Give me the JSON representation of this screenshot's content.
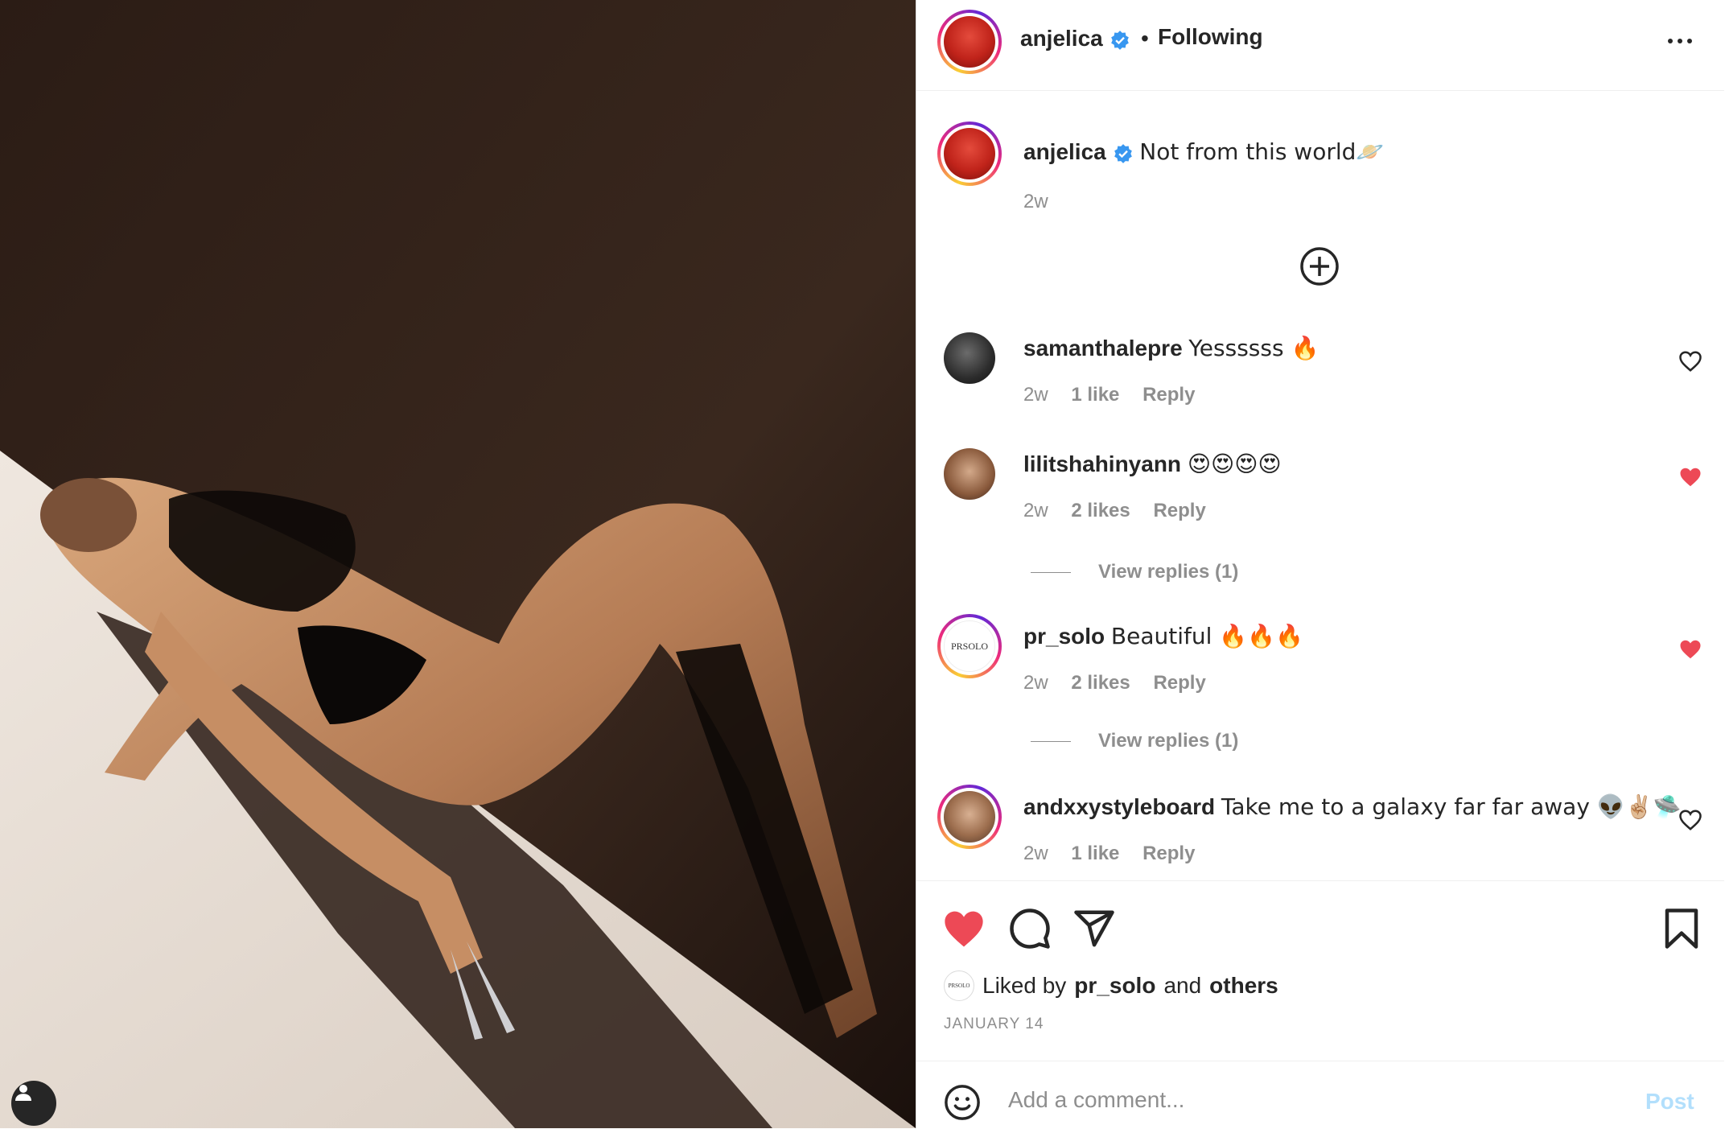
{
  "post": {
    "author": "anjelica",
    "follow_status": "Following",
    "separator": "•",
    "caption": "Not from this world🪐",
    "caption_age": "2w",
    "date": "JANUARY 14"
  },
  "comments": [
    {
      "user": "samanthalepre",
      "text": "Yessssss 🔥",
      "age": "2w",
      "likes": "1 like",
      "reply": "Reply",
      "liked": false
    },
    {
      "user": "lilitshahinyann",
      "text": "😍😍😍😍",
      "age": "2w",
      "likes": "2 likes",
      "reply": "Reply",
      "liked": true,
      "view_replies": "View replies (1)"
    },
    {
      "user": "pr_solo",
      "text": "Beautiful 🔥🔥🔥",
      "age": "2w",
      "likes": "2 likes",
      "reply": "Reply",
      "liked": true,
      "view_replies": "View replies (1)",
      "avatar_text": "PRSOLO"
    },
    {
      "user": "andxxystyleboard",
      "text": "Take me to a galaxy far far away 👽✌🏼🛸",
      "age": "2w",
      "likes": "1 like",
      "reply": "Reply",
      "liked": false
    }
  ],
  "likes_line": {
    "prefix": "Liked by",
    "user": "pr_solo",
    "conj": "and",
    "others": "others",
    "mini_avatar_text": "PRSOLO"
  },
  "composer": {
    "placeholder": "Add a comment...",
    "post_label": "Post"
  },
  "colors": {
    "like_red": "#ed4956",
    "verified_blue": "#3897f0",
    "post_disabled": "#b2dffc",
    "muted": "#8e8e8e"
  },
  "icons": [
    "verified-badge-icon",
    "more-options-icon",
    "load-more-comments-icon",
    "heart-icon",
    "comment-icon",
    "share-icon",
    "bookmark-icon",
    "emoji-icon",
    "user-icon"
  ]
}
